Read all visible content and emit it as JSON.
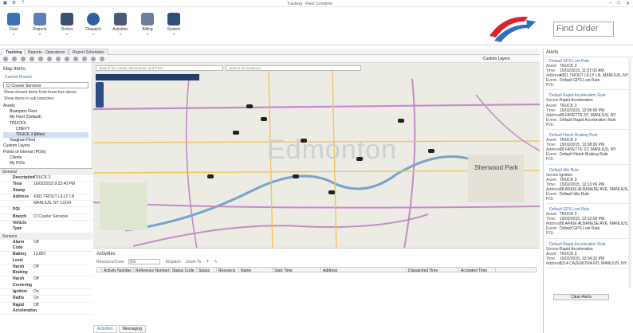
{
  "window": {
    "title": "Tracking - Fleet Complete"
  },
  "ribbon": {
    "buttons": [
      {
        "label": "Fleet",
        "color": "#3b6fb6"
      },
      {
        "label": "Reports",
        "color": "#3b6fb6"
      },
      {
        "label": "Orders",
        "color": "#3b6fb6"
      },
      {
        "label": "Dispatch",
        "color": "#3b6fb6"
      },
      {
        "label": "Activities",
        "color": "#3b6fb6"
      },
      {
        "label": "Billing",
        "color": "#3b6fb6"
      },
      {
        "label": "System",
        "color": "#3b6fb6"
      }
    ],
    "find_placeholder": "Find Order"
  },
  "tabs": [
    "Tracking",
    "Reports - Operations",
    "Report Schedules"
  ],
  "toolbar": {
    "custom_layers": "Custom Layers"
  },
  "left": {
    "title": "Map Items",
    "current_branch_label": "Current Branch",
    "branch_value": "CI Courier Services",
    "check1": "Show shared items from branches above",
    "check2": "Show items in sub branches",
    "tree": [
      "Assets",
      "Brampton Fleet",
      "My Fleet (Default)",
      "TRUCKS",
      "CHEVY",
      "TRUCK 3 [Mike]",
      "Vaughan Fleet",
      "Custom Layers",
      "Points of Interest (POIs)",
      "Clients",
      "My POIs"
    ]
  },
  "properties": {
    "general_label": "General",
    "general": [
      {
        "k": "Description",
        "v": "TRUCK 3"
      },
      {
        "k": "Time Stamp",
        "v": "16/02/2015 9:23:40 PM"
      },
      {
        "k": "Address",
        "v": "4301 TROUT LILLY LN"
      },
      {
        "k": "",
        "v": "MANLIUS, NY 13104"
      },
      {
        "k": "POI",
        "v": ""
      },
      {
        "k": "Branch",
        "v": "CI Courier Services"
      },
      {
        "k": "Vehicle Type",
        "v": ""
      }
    ],
    "sensors_label": "Sensors",
    "sensors": [
      {
        "k": "Alarm Code",
        "v": "Off"
      },
      {
        "k": "Battery Level",
        "v": "12.85V"
      },
      {
        "k": "Harsh Braking",
        "v": "Off"
      },
      {
        "k": "Harsh Cornering",
        "v": "Off"
      },
      {
        "k": "Ignition",
        "v": "On"
      },
      {
        "k": "Radio",
        "v": "On"
      },
      {
        "k": "Rapid Acceleration",
        "v": "Off"
      }
    ]
  },
  "map": {
    "search_assets_placeholder": "Search for Assets, Resources, and POIs",
    "search_locations_placeholder": "Search for locations",
    "watermark": "Edmonton",
    "sherwood": "Sherwood Park"
  },
  "activities": {
    "title": "Activities",
    "resource_label": "Resource/Crew",
    "resource_value": "(No",
    "dispatch_label": "Dispatch",
    "zoom_label": "Zoom To",
    "columns": [
      "Activity Number",
      "Reference Number",
      "Status Code",
      "Status",
      "Resource",
      "Name",
      "Start Time",
      "Address",
      "Dispatched Time",
      "Accepted Time"
    ],
    "tabs": [
      "Activities",
      "Messaging"
    ]
  },
  "alerts": {
    "title": "Alerts",
    "items": [
      {
        "title": "Default GPS Lost Rule",
        "sensor": "",
        "asset": "TRUCK 3",
        "time": "15/02/2015, 11:57:00 AM",
        "address": "4301 TROUT LILLY LN, MANLIUS, NY",
        "event": "Default GPS Lost Rule",
        "poi": ""
      },
      {
        "title": "Default Rapid Acceleration Rule",
        "sensor": "Rapid Acceleration",
        "asset": "TRUCK 3",
        "time": "15/02/2015, 12:06:00 PM",
        "address": "29 FAYETTE ST, MANLIUS, NY",
        "event": "Default Rapid Acceleration Rule",
        "poi": ""
      },
      {
        "title": "Default Harsh Braking Rule",
        "sensor": "",
        "asset": "TRUCK 3",
        "time": "15/02/2015, 12:08:00 PM",
        "address": "29 FAYETTE ST, MANLIUS, NY",
        "event": "Default Harsh Braking Rule",
        "poi": ""
      },
      {
        "title": "Default Idle Rule",
        "sensor": "Ignition",
        "asset": "TRUCK 3",
        "time": "15/02/2015, 12:13:06 PM",
        "address": "28 ARKIE ALBANESE AVE, MANLIUS,",
        "event": "Default Idle Rule",
        "poi": ""
      },
      {
        "title": "Default GPS Lost Rule",
        "sensor": "",
        "asset": "TRUCK 3",
        "time": "15/02/2015, 12:32:06 PM",
        "address": "28 ARKIE ALBANESE AVE, MANLIUS,",
        "event": "Default GPS Lost Rule",
        "poi": ""
      },
      {
        "title": "Default Rapid Acceleration Rule",
        "sensor": "Rapid Acceleration",
        "asset": "TRUCK 3",
        "time": "15/02/2015, 12:34:32 PM",
        "address": "8114 CAZENOVIA RD, MANLIUS, NY",
        "event": "Default Rapid Acceleration Rule",
        "poi": ""
      }
    ],
    "labels": {
      "asset": "Asset:",
      "time": "Time:",
      "address": "Address:",
      "event": "Event:",
      "poi": "POI:",
      "sensor": "Sensor:"
    },
    "clear_label": "Clear Alerts"
  }
}
